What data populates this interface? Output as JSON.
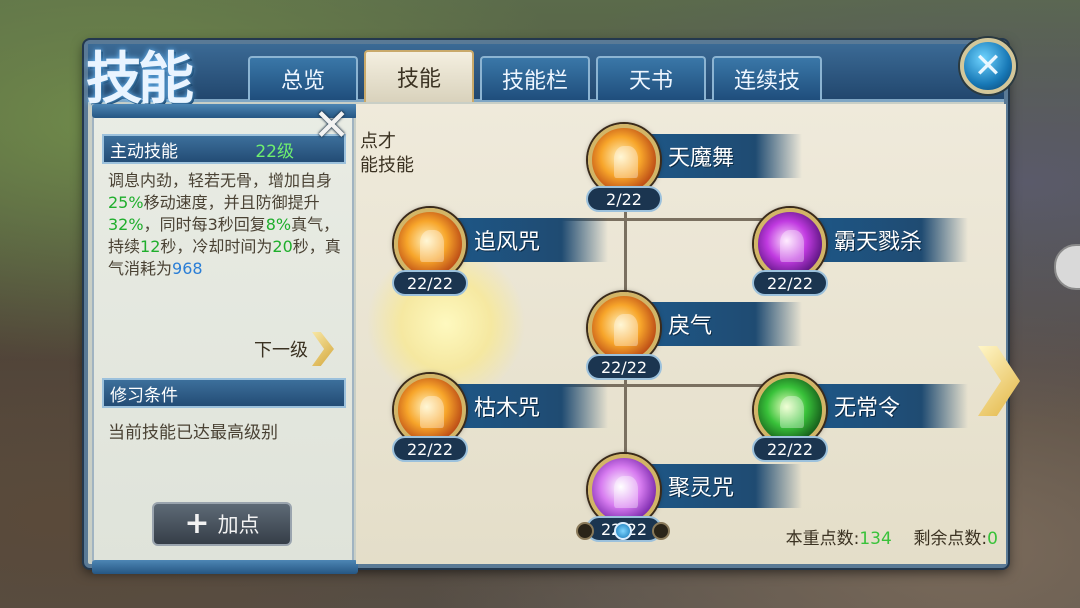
{
  "window": {
    "title": "技能",
    "close_icon": "close-icon"
  },
  "tabs": [
    {
      "label": "总览",
      "active": false
    },
    {
      "label": "技能",
      "active": true
    },
    {
      "label": "技能栏",
      "active": false
    },
    {
      "label": "天书",
      "active": false
    },
    {
      "label": "连续技",
      "active": false
    }
  ],
  "detail": {
    "section_title": "主动技能",
    "level": "22级",
    "description_parts": [
      {
        "t": "调息内劲，轻若无骨，增加自身",
        "c": ""
      },
      {
        "t": "25%",
        "c": "g"
      },
      {
        "t": "移动速度，并且防御提升",
        "c": ""
      },
      {
        "t": "32%",
        "c": "g"
      },
      {
        "t": "，同时每3秒回复",
        "c": ""
      },
      {
        "t": "8%",
        "c": "g"
      },
      {
        "t": "真气，持续",
        "c": ""
      },
      {
        "t": "12",
        "c": "g"
      },
      {
        "t": "秒，冷却时间为",
        "c": ""
      },
      {
        "t": "20",
        "c": "g"
      },
      {
        "t": "秒，真气消耗为",
        "c": ""
      },
      {
        "t": "968",
        "c": "b"
      }
    ],
    "next_level_label": "下一级",
    "requirement_title": "修习条件",
    "requirement_text": "当前技能已达最高级别",
    "add_point_label": "加点"
  },
  "main": {
    "partial_text": [
      "点才",
      "能技能"
    ],
    "skills": [
      {
        "name": "天魔舞",
        "count": "2/22",
        "color": "fire"
      },
      {
        "name": "追风咒",
        "count": "22/22",
        "color": "fire"
      },
      {
        "name": "霸天戮杀",
        "count": "22/22",
        "color": "purple"
      },
      {
        "name": "戾气",
        "count": "22/22",
        "color": "fire"
      },
      {
        "name": "枯木咒",
        "count": "22/22",
        "color": "fire"
      },
      {
        "name": "无常令",
        "count": "22/22",
        "color": "green"
      },
      {
        "name": "聚灵咒",
        "count": "22/22",
        "color": "violet"
      }
    ],
    "pager": {
      "pages": 3,
      "current": 2
    },
    "points": {
      "spent_label": "本重点数:",
      "spent_value": "134",
      "remaining_label": "剩余点数:",
      "remaining_value": "0"
    }
  }
}
